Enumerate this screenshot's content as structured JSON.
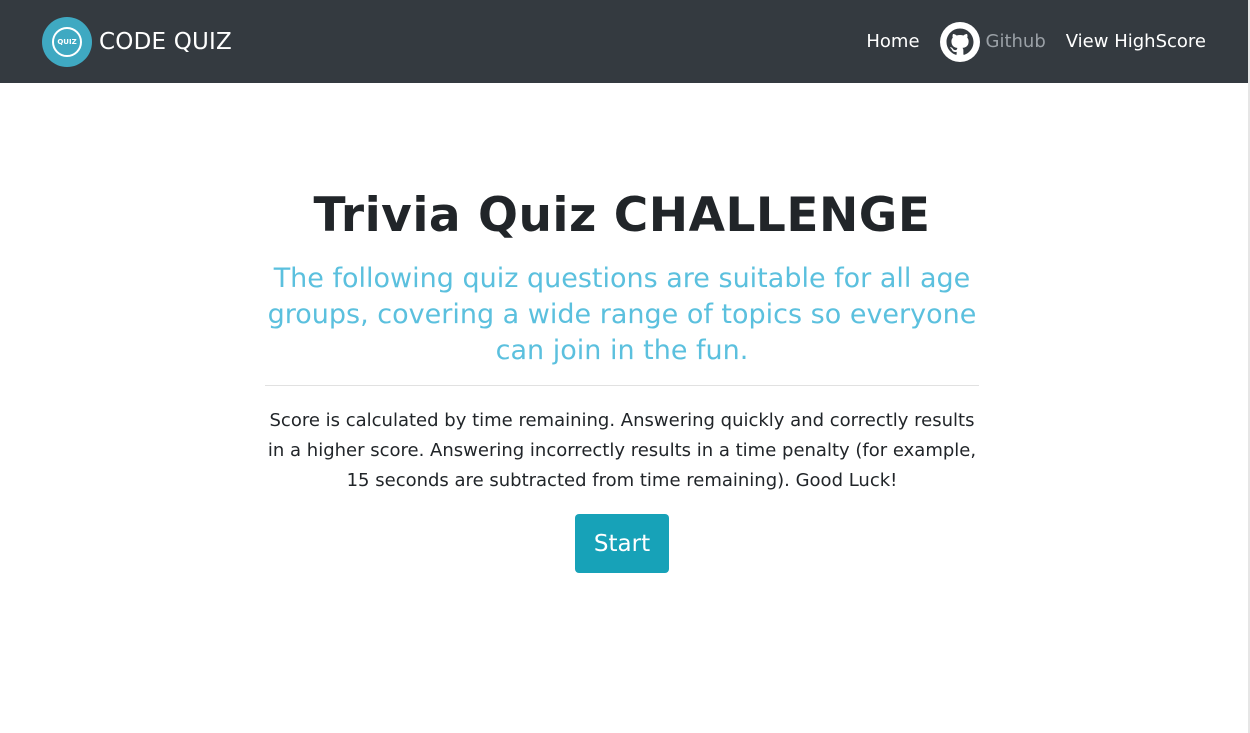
{
  "navbar": {
    "logo_text": "QUIZ",
    "brand_name": "CODE QUIZ",
    "links": {
      "home": "Home",
      "github": "Github",
      "highscore": "View HighScore"
    }
  },
  "hero": {
    "title": "Trivia Quiz CHALLENGE",
    "subtitle": "The following quiz questions are suitable for all age groups, covering a wide range of topics so everyone can join in the fun.",
    "rules": "Score is calculated by time remaining. Answering quickly and correctly results in a higher score. Answering incorrectly results in a time penalty (for example, 15 seconds are subtracted from time remaining). Good Luck!",
    "start_label": "Start"
  },
  "colors": {
    "navbar_bg": "#343a40",
    "accent": "#17a2b8",
    "subtitle": "#5bc0de",
    "text": "#212529"
  },
  "icons": {
    "logo": "quiz-logo-icon",
    "github": "github-icon"
  }
}
